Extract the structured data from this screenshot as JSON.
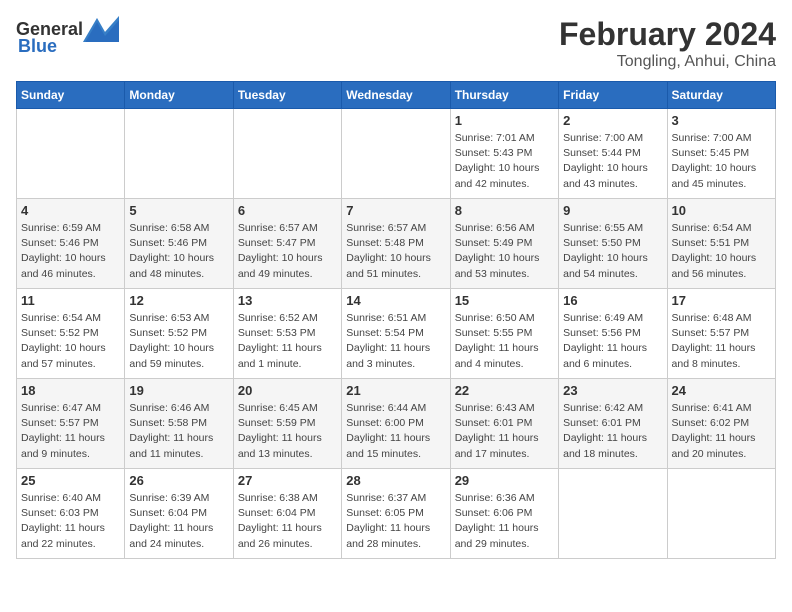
{
  "header": {
    "logo_general": "General",
    "logo_blue": "Blue",
    "title": "February 2024",
    "subtitle": "Tongling, Anhui, China"
  },
  "calendar": {
    "days_of_week": [
      "Sunday",
      "Monday",
      "Tuesday",
      "Wednesday",
      "Thursday",
      "Friday",
      "Saturday"
    ],
    "weeks": [
      [
        {
          "day": "",
          "info": ""
        },
        {
          "day": "",
          "info": ""
        },
        {
          "day": "",
          "info": ""
        },
        {
          "day": "",
          "info": ""
        },
        {
          "day": "1",
          "info": "Sunrise: 7:01 AM\nSunset: 5:43 PM\nDaylight: 10 hours\nand 42 minutes."
        },
        {
          "day": "2",
          "info": "Sunrise: 7:00 AM\nSunset: 5:44 PM\nDaylight: 10 hours\nand 43 minutes."
        },
        {
          "day": "3",
          "info": "Sunrise: 7:00 AM\nSunset: 5:45 PM\nDaylight: 10 hours\nand 45 minutes."
        }
      ],
      [
        {
          "day": "4",
          "info": "Sunrise: 6:59 AM\nSunset: 5:46 PM\nDaylight: 10 hours\nand 46 minutes."
        },
        {
          "day": "5",
          "info": "Sunrise: 6:58 AM\nSunset: 5:46 PM\nDaylight: 10 hours\nand 48 minutes."
        },
        {
          "day": "6",
          "info": "Sunrise: 6:57 AM\nSunset: 5:47 PM\nDaylight: 10 hours\nand 49 minutes."
        },
        {
          "day": "7",
          "info": "Sunrise: 6:57 AM\nSunset: 5:48 PM\nDaylight: 10 hours\nand 51 minutes."
        },
        {
          "day": "8",
          "info": "Sunrise: 6:56 AM\nSunset: 5:49 PM\nDaylight: 10 hours\nand 53 minutes."
        },
        {
          "day": "9",
          "info": "Sunrise: 6:55 AM\nSunset: 5:50 PM\nDaylight: 10 hours\nand 54 minutes."
        },
        {
          "day": "10",
          "info": "Sunrise: 6:54 AM\nSunset: 5:51 PM\nDaylight: 10 hours\nand 56 minutes."
        }
      ],
      [
        {
          "day": "11",
          "info": "Sunrise: 6:54 AM\nSunset: 5:52 PM\nDaylight: 10 hours\nand 57 minutes."
        },
        {
          "day": "12",
          "info": "Sunrise: 6:53 AM\nSunset: 5:52 PM\nDaylight: 10 hours\nand 59 minutes."
        },
        {
          "day": "13",
          "info": "Sunrise: 6:52 AM\nSunset: 5:53 PM\nDaylight: 11 hours\nand 1 minute."
        },
        {
          "day": "14",
          "info": "Sunrise: 6:51 AM\nSunset: 5:54 PM\nDaylight: 11 hours\nand 3 minutes."
        },
        {
          "day": "15",
          "info": "Sunrise: 6:50 AM\nSunset: 5:55 PM\nDaylight: 11 hours\nand 4 minutes."
        },
        {
          "day": "16",
          "info": "Sunrise: 6:49 AM\nSunset: 5:56 PM\nDaylight: 11 hours\nand 6 minutes."
        },
        {
          "day": "17",
          "info": "Sunrise: 6:48 AM\nSunset: 5:57 PM\nDaylight: 11 hours\nand 8 minutes."
        }
      ],
      [
        {
          "day": "18",
          "info": "Sunrise: 6:47 AM\nSunset: 5:57 PM\nDaylight: 11 hours\nand 9 minutes."
        },
        {
          "day": "19",
          "info": "Sunrise: 6:46 AM\nSunset: 5:58 PM\nDaylight: 11 hours\nand 11 minutes."
        },
        {
          "day": "20",
          "info": "Sunrise: 6:45 AM\nSunset: 5:59 PM\nDaylight: 11 hours\nand 13 minutes."
        },
        {
          "day": "21",
          "info": "Sunrise: 6:44 AM\nSunset: 6:00 PM\nDaylight: 11 hours\nand 15 minutes."
        },
        {
          "day": "22",
          "info": "Sunrise: 6:43 AM\nSunset: 6:01 PM\nDaylight: 11 hours\nand 17 minutes."
        },
        {
          "day": "23",
          "info": "Sunrise: 6:42 AM\nSunset: 6:01 PM\nDaylight: 11 hours\nand 18 minutes."
        },
        {
          "day": "24",
          "info": "Sunrise: 6:41 AM\nSunset: 6:02 PM\nDaylight: 11 hours\nand 20 minutes."
        }
      ],
      [
        {
          "day": "25",
          "info": "Sunrise: 6:40 AM\nSunset: 6:03 PM\nDaylight: 11 hours\nand 22 minutes."
        },
        {
          "day": "26",
          "info": "Sunrise: 6:39 AM\nSunset: 6:04 PM\nDaylight: 11 hours\nand 24 minutes."
        },
        {
          "day": "27",
          "info": "Sunrise: 6:38 AM\nSunset: 6:04 PM\nDaylight: 11 hours\nand 26 minutes."
        },
        {
          "day": "28",
          "info": "Sunrise: 6:37 AM\nSunset: 6:05 PM\nDaylight: 11 hours\nand 28 minutes."
        },
        {
          "day": "29",
          "info": "Sunrise: 6:36 AM\nSunset: 6:06 PM\nDaylight: 11 hours\nand 29 minutes."
        },
        {
          "day": "",
          "info": ""
        },
        {
          "day": "",
          "info": ""
        }
      ]
    ]
  }
}
